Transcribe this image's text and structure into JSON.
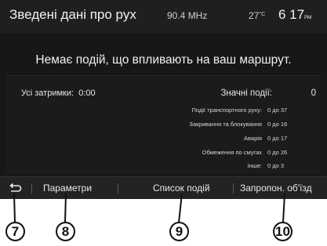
{
  "status_bar": {
    "title": "Зведені дані про рух",
    "radio": "90.4 MHz",
    "temperature": "27",
    "temperature_unit": "°C",
    "time": "6 17",
    "time_suffix": "PM"
  },
  "headline": "Немає подій, що впливають на ваш маршрут.",
  "summary": {
    "delays_label": "Усі затримки:",
    "delays_value": "0:00",
    "significant_label": "Значні події:",
    "significant_value": "0"
  },
  "events": [
    {
      "label": "Події транспортного руху:",
      "value": "0 до 37"
    },
    {
      "label": "Закривання та блокування",
      "value": "0 до 16"
    },
    {
      "label": "Аварія",
      "value": "0 до 17"
    },
    {
      "label": "Обмеження по смугах",
      "value": "0 до 26"
    },
    {
      "label": "Інше:",
      "value": "0 до 3"
    }
  ],
  "toolbar": {
    "back_icon": "back-arrow-icon",
    "settings_label": "Параметри",
    "events_list_label": "Список подій",
    "detour_label": "Запропон. об'їзд"
  },
  "callouts": [
    "7",
    "8",
    "9",
    "10"
  ]
}
